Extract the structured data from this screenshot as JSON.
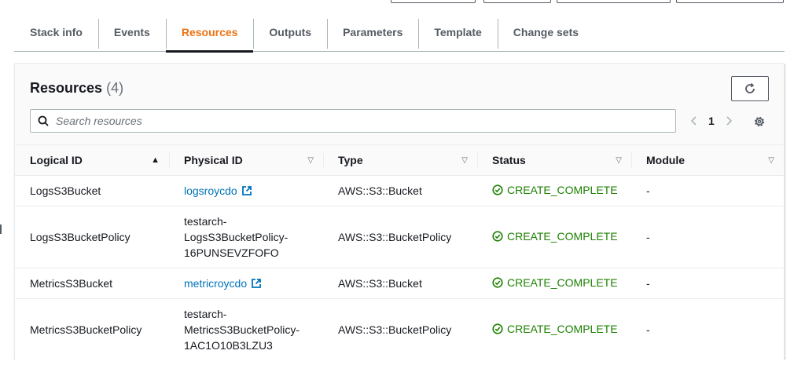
{
  "tabs": [
    {
      "label": "Stack info",
      "active": false
    },
    {
      "label": "Events",
      "active": false
    },
    {
      "label": "Resources",
      "active": true
    },
    {
      "label": "Outputs",
      "active": false
    },
    {
      "label": "Parameters",
      "active": false
    },
    {
      "label": "Template",
      "active": false
    },
    {
      "label": "Change sets",
      "active": false
    }
  ],
  "panel": {
    "title": "Resources",
    "count": "(4)"
  },
  "search": {
    "placeholder": "Search resources"
  },
  "pagination": {
    "page": "1"
  },
  "table": {
    "headers": [
      "Logical ID",
      "Physical ID",
      "Type",
      "Status",
      "Module"
    ],
    "rows": [
      {
        "logical_id": "LogsS3Bucket",
        "physical_id": "logsroycdo",
        "physical_is_link": true,
        "type": "AWS::S3::Bucket",
        "status": "CREATE_COMPLETE",
        "module": "-"
      },
      {
        "logical_id": "LogsS3BucketPolicy",
        "physical_id": "testarch-\nLogsS3BucketPolicy-\n16PUNSEVZFOFO",
        "physical_is_link": false,
        "type": "AWS::S3::BucketPolicy",
        "status": "CREATE_COMPLETE",
        "module": "-"
      },
      {
        "logical_id": "MetricsS3Bucket",
        "physical_id": "metricroycdo",
        "physical_is_link": true,
        "type": "AWS::S3::Bucket",
        "status": "CREATE_COMPLETE",
        "module": "-"
      },
      {
        "logical_id": "MetricsS3BucketPolicy",
        "physical_id": "testarch-\nMetricsS3BucketPolicy-\n1AC1O10B3LZU3",
        "physical_is_link": false,
        "type": "AWS::S3::BucketPolicy",
        "status": "CREATE_COMPLETE",
        "module": "-"
      }
    ]
  },
  "colors": {
    "accent": "#ec7211",
    "link": "#0073bb",
    "success": "#1d8102"
  }
}
